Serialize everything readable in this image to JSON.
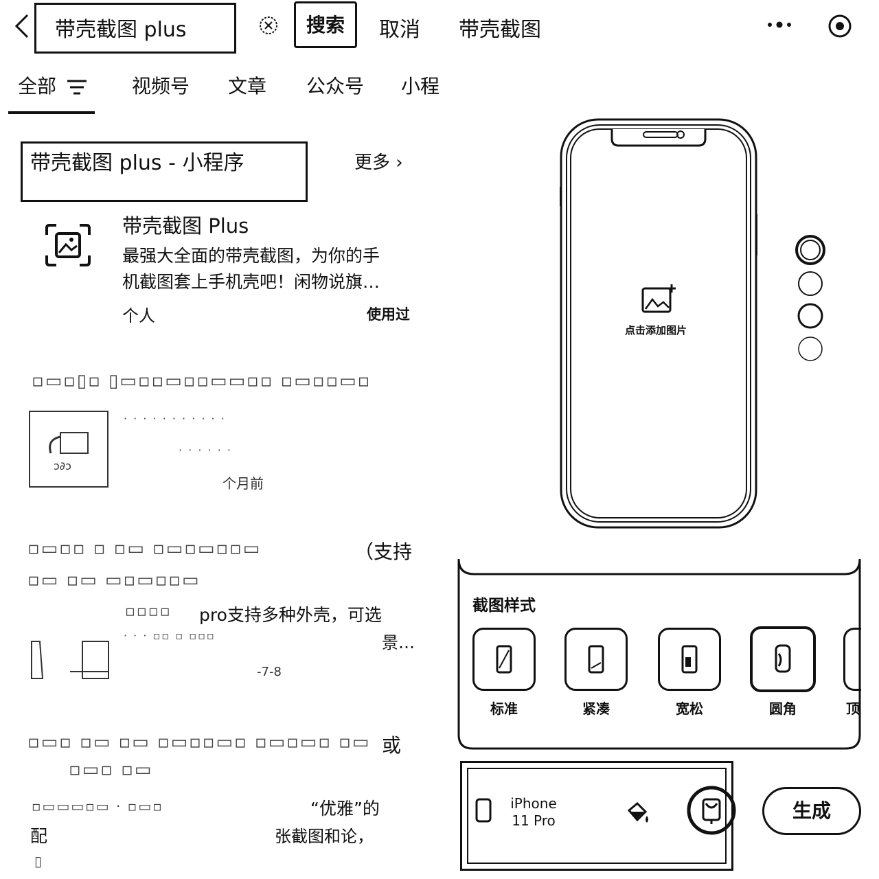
{
  "topbar": {
    "search_query": "带壳截图 plus",
    "search_label": "搜索",
    "cancel_label": "取消",
    "page_name": "带壳截图"
  },
  "tabs": [
    "全部",
    "视频号",
    "文章",
    "公众号",
    "小程"
  ],
  "section": {
    "title": "带壳截图 plus - 小程序",
    "more_label": "更多"
  },
  "app": {
    "name": "带壳截图 Plus",
    "desc_line1": "最强大全面的带壳截图，为你的手",
    "desc_line2": "机截图套上手机壳吧！闲物说旗…",
    "author": "个人",
    "used": "使用过"
  },
  "results": {
    "r1_time": "个月前",
    "r2_title_tail": "（支持",
    "r2_desc1": "pro支持多种外壳，可选",
    "r2_desc2": "景…",
    "r2_date": "-7-8",
    "r3_title_tail": "或",
    "r3_desc1": "“优雅”的",
    "r3_desc2": "配",
    "r3_desc3": "张截图和论，"
  },
  "preview": {
    "add_label": "点击添加图片"
  },
  "styles_panel": {
    "title": "截图样式",
    "items": [
      "标准",
      "紧凑",
      "宽松",
      "圆角",
      "顶"
    ]
  },
  "bottom": {
    "device": "iPhone 11 Pro",
    "generate": "生成"
  }
}
